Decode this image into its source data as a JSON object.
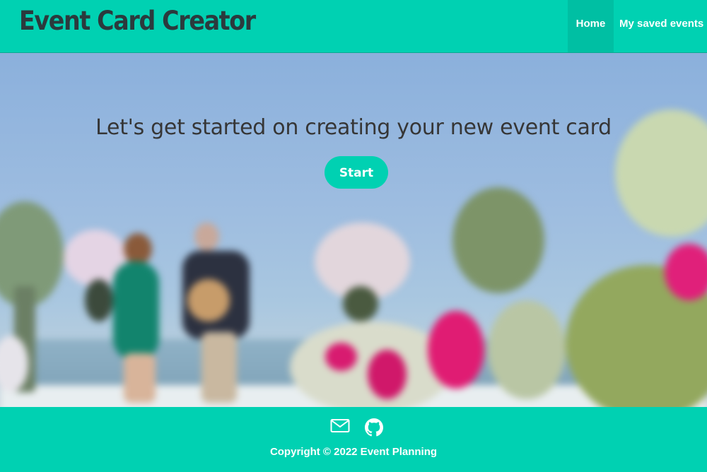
{
  "navbar": {
    "brand": "Event Card Creator",
    "items": [
      {
        "label": "Home"
      },
      {
        "label": "My saved events"
      }
    ]
  },
  "hero": {
    "headline": "Let's get started on creating your new event card",
    "start_label": "Start"
  },
  "footer": {
    "icons": [
      "mail-icon",
      "github-icon"
    ],
    "copyright": "Copyright © 2022 Event Planning"
  },
  "colors": {
    "primary": "#00d1b2",
    "brand_text": "#2b3a3d",
    "headline_text": "#363636",
    "white": "#ffffff"
  }
}
